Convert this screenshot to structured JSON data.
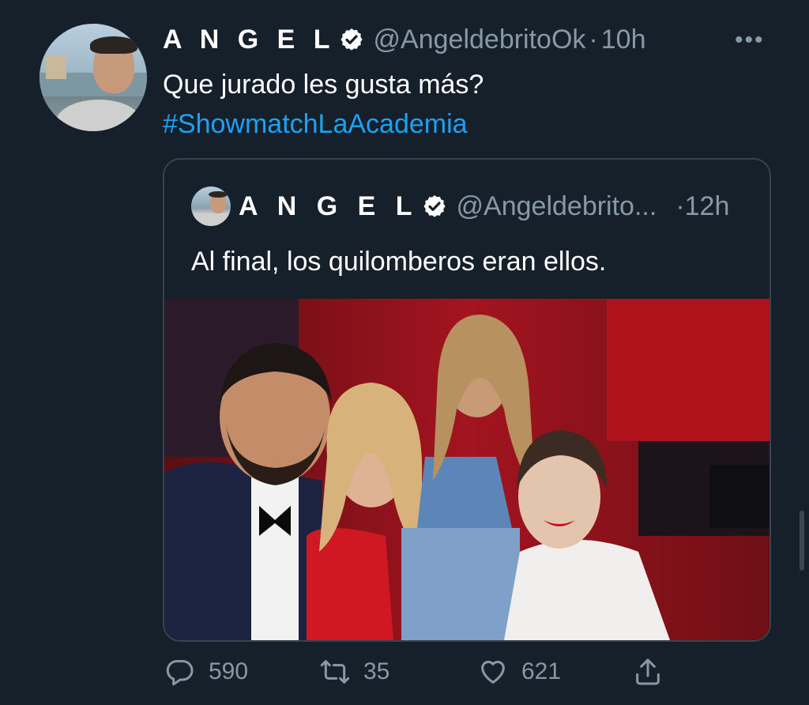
{
  "tweet": {
    "author_name": "A N G E L",
    "handle": "@AngeldebritoOk",
    "separator": "·",
    "time": "10h",
    "more": "•••",
    "text": "Que jurado les gusta más?",
    "hashtag": "#ShowmatchLaAcademia"
  },
  "quoted": {
    "author_name": "A N G E L",
    "handle": "@Angeldebrito...",
    "time": "·12h",
    "text": "Al final, los quilomberos eran ellos."
  },
  "actions": {
    "replies": "590",
    "retweets": "35",
    "likes": "621"
  },
  "colors": {
    "background": "#15202b",
    "accent": "#1da1f2",
    "muted": "#8899a6",
    "border": "#38444d"
  },
  "icons": [
    "verified-badge-icon",
    "more-icon",
    "reply-icon",
    "retweet-icon",
    "like-icon",
    "share-icon"
  ]
}
